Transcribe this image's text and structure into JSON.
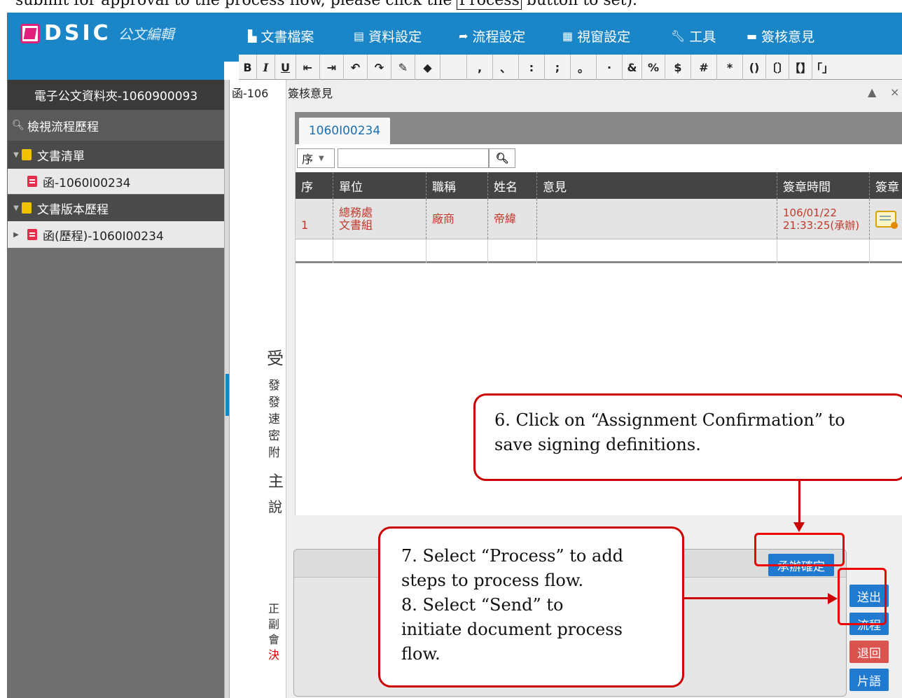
{
  "caption": {
    "text_before": "submit for approval to the process flow, please click the ",
    "boxed_word": "Process",
    "text_after": " button to set)."
  },
  "app": {
    "logo_text": "DSIC",
    "logo_subtitle": "公文編輯",
    "brand_color": "#1a86c8",
    "accent_color": "#e0207a"
  },
  "menu": [
    {
      "label": "文書檔案",
      "icon": "file-icon"
    },
    {
      "label": "資料設定",
      "icon": "list-icon"
    },
    {
      "label": "流程設定",
      "icon": "share-arrow-icon"
    },
    {
      "label": "視窗設定",
      "icon": "grid-icon"
    },
    {
      "label": "工具",
      "icon": "wrench-icon"
    },
    {
      "label": "簽核意見",
      "icon": "comment-icon"
    }
  ],
  "toolbar": {
    "bold": "B",
    "italic": "I",
    "underline": "U",
    "punct": [
      ",",
      "、",
      ":",
      ";",
      "。",
      "·",
      "&",
      "%",
      "$",
      "#",
      "*",
      "()",
      "〔〕",
      "【】",
      "「」"
    ]
  },
  "sidebar": {
    "folder_title": "電子公文資料夾-1060900093",
    "view_history": "檢視流程歷程",
    "doc_list": "文書清單",
    "doc_item": "函-1060I00234",
    "version_history": "文書版本歷程",
    "version_item": "函(歷程)-1060I00234"
  },
  "doc_strip": {
    "tab_label": "函-106",
    "chars_top": [
      "受",
      "發",
      "發",
      "速",
      "密",
      "附",
      "主",
      "說"
    ],
    "chars_bottom": [
      "正",
      "副",
      "會",
      "決"
    ]
  },
  "panel": {
    "title": "簽核意見",
    "collapse_icon": "▲",
    "close_icon": "×",
    "tab": "1060I00234",
    "seq_select": "序",
    "columns": [
      "序",
      "單位",
      "職稱",
      "姓名",
      "意見",
      "簽章時間",
      "簽章"
    ],
    "row": {
      "seq": "1",
      "unit_line1": "總務處",
      "unit_line2": "文書組",
      "title": "廠商",
      "name": "帝緯",
      "opinion": "",
      "time_line1": "106/01/22",
      "time_line2": "21:33:25(承辦)"
    }
  },
  "buttons": {
    "confirm": "承辦確定",
    "send": "送出",
    "process": "流程",
    "return": "退回",
    "phrase": "片語"
  },
  "annotations": {
    "step6_line1": "6. Click on “Assignment Confirmation” to",
    "step6_line2": "save signing definitions.",
    "step7_line1": "7. Select “Process” to add",
    "step7_line2": "steps to process flow.",
    "step8_line1": "8. Select “Send”  to",
    "step8_line2": "initiate document process",
    "step8_line3": "flow."
  }
}
